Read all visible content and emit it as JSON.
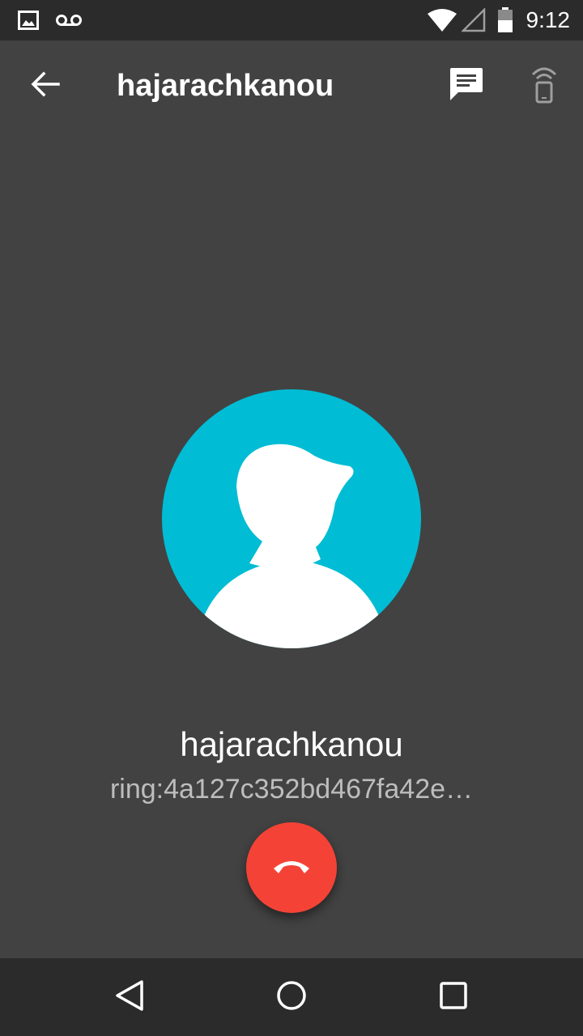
{
  "status_bar": {
    "time": "9:12",
    "icons": [
      "image-notification-icon",
      "voicemail-icon",
      "wifi-icon",
      "cell-signal-icon",
      "battery-icon"
    ]
  },
  "app_bar": {
    "title": "hajarachkanou",
    "actions": [
      "message-icon",
      "ring-cast-icon"
    ]
  },
  "call": {
    "contact_name": "hajarachkanou",
    "contact_uri": "ring:4a127c352bd467fa42e…",
    "avatar_color": "#00bcd4"
  },
  "hangup": {
    "icon": "call-end-icon",
    "color": "#f44336"
  },
  "nav_bar": {
    "buttons": [
      "back-triangle-icon",
      "home-circle-icon",
      "recents-square-icon"
    ]
  }
}
